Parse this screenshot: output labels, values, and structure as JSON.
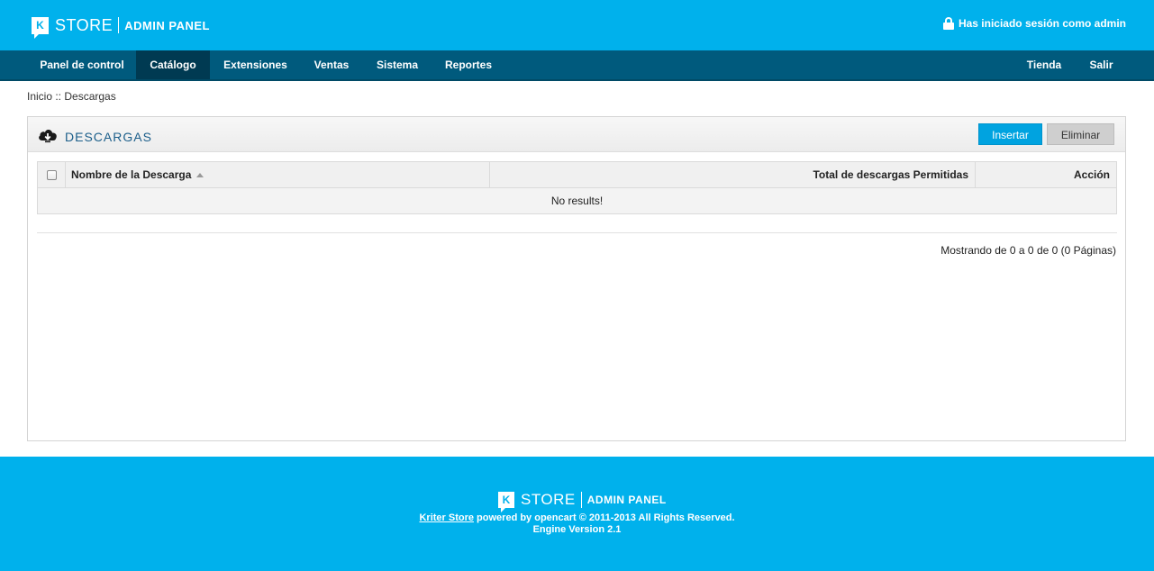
{
  "header": {
    "logo_letter": "K",
    "logo_store": "STORE",
    "logo_admin": "ADMIN PANEL",
    "login_text": "Has iniciado sesión como admin"
  },
  "nav": {
    "items": [
      {
        "label": "Panel de control"
      },
      {
        "label": "Catálogo",
        "active": true
      },
      {
        "label": "Extensiones"
      },
      {
        "label": "Ventas"
      },
      {
        "label": "Sistema"
      },
      {
        "label": "Reportes"
      }
    ],
    "right": [
      {
        "label": "Tienda"
      },
      {
        "label": "Salir"
      }
    ]
  },
  "breadcrumb": "Inicio :: Descargas",
  "panel": {
    "title": "DESCARGAS",
    "insert_label": "Insertar",
    "delete_label": "Eliminar",
    "table": {
      "columns": [
        "Nombre de la Descarga",
        "Total de descargas Permitidas",
        "Acción"
      ],
      "empty_text": "No results!"
    },
    "pagination": "Mostrando de 0 a 0 de 0 (0 Páginas)"
  },
  "footer": {
    "logo_letter": "K",
    "logo_store": "STORE",
    "logo_admin": "ADMIN PANEL",
    "link_text": "Kriter Store",
    "line1_rest": " powered by opencart © 2011-2013 All Rights Reserved.",
    "line2": "Engine Version 2.1"
  },
  "colors": {
    "brand_blue": "#00b1ec",
    "nav_dark": "#005a7d",
    "nav_active": "#003a52"
  },
  "icons": {
    "lock": "lock-icon",
    "cloud_download": "cloud-download-icon",
    "sort_asc": "sort-asc-icon"
  }
}
